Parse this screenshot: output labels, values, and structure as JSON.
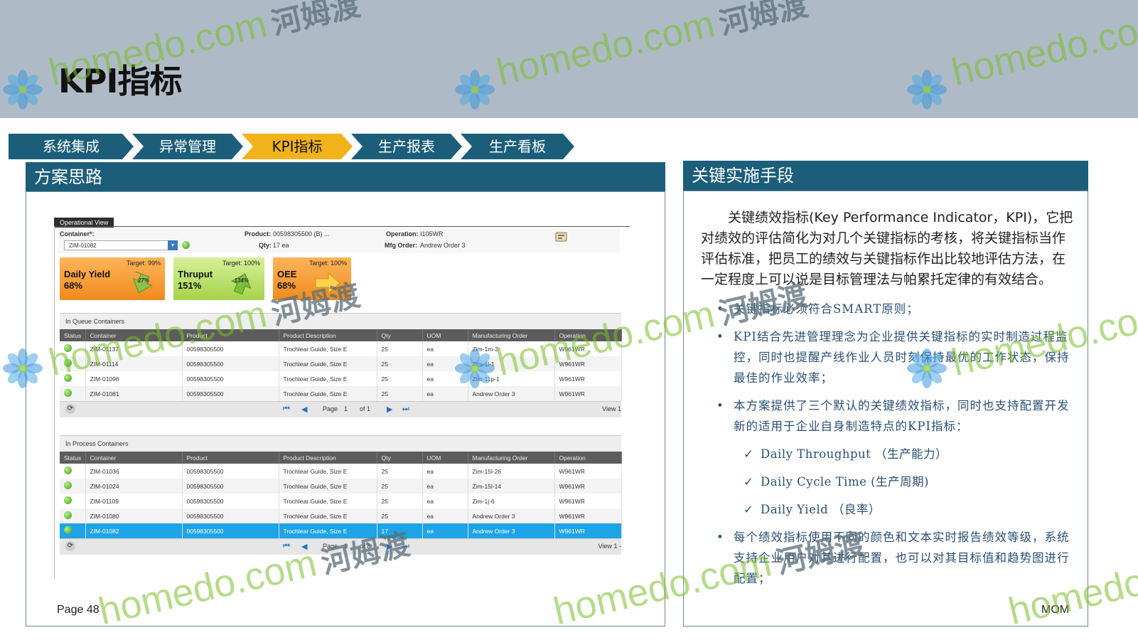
{
  "page_title": "KPI指标",
  "nav": [
    {
      "label": "系统集成",
      "active": false
    },
    {
      "label": "异常管理",
      "active": false
    },
    {
      "label": "KPI指标",
      "active": true
    },
    {
      "label": "生产报表",
      "active": false
    },
    {
      "label": "生产看板",
      "active": false
    }
  ],
  "left_panel": {
    "title": "方案思路"
  },
  "right_panel": {
    "title": "关键实施手段"
  },
  "watermark": {
    "text": "homedo.com",
    "cn": "河姆渡"
  },
  "screen": {
    "tab": "Operational View",
    "container_label": "Container*:",
    "container_value": "ZIM-01082",
    "product_label": "Product:",
    "product_value": "00598305500 (B) ...",
    "qty_label": "Qty:",
    "qty_value": "17 ea",
    "operation_label": "Operation:",
    "operation_value": "I105WR",
    "mfg_label": "Mfg Order:",
    "mfg_value": "Andrew Order 3",
    "kpis": [
      {
        "name": "Daily Yield",
        "value": "68%",
        "target": "Target: 99%",
        "pct": "27%",
        "color": "#f4902a"
      },
      {
        "name": "Thruput",
        "value": "151%",
        "target": "Target: 100%",
        "pct": "134%",
        "color": "#9ccf3e"
      },
      {
        "name": "OEE",
        "value": "68%",
        "target": "Target: 100%",
        "pct": "",
        "color": "#f4902a"
      }
    ],
    "queue": {
      "caption": "In Queue Containers",
      "columns": [
        "Status",
        "Container",
        "Product",
        "Product Description",
        "Qty",
        "UOM",
        "Manufacturing Order",
        "Operation"
      ],
      "rows": [
        [
          "",
          "ZIM-01137",
          "00598305500",
          "Trochlear Guide, Size E",
          "25",
          "ea",
          "Zim-1m-3",
          "W961WR"
        ],
        [
          "",
          "ZIM-01114",
          "00598305500",
          "Trochlear Guide, Size E",
          "25",
          "ea",
          "Zim-1i-1",
          "W961WR"
        ],
        [
          "",
          "ZIM-01096",
          "00598305500",
          "Trochlear Guide, Size E",
          "25",
          "ea",
          "Zim-11p-1",
          "W961WR"
        ],
        [
          "",
          "ZIM-01081",
          "00598305500",
          "Trochlear Guide, Size E",
          "25",
          "ea",
          "Andrew Order 3",
          "W961WR"
        ]
      ],
      "page_label": "Page",
      "page_value": "1",
      "of_label": "of 1",
      "view_label": "View 1"
    },
    "process": {
      "caption": "In Process Containers",
      "columns": [
        "Status",
        "Container",
        "Product",
        "Product Description",
        "Qty",
        "UOM",
        "Manufacturing Order",
        "Operation"
      ],
      "rows": [
        [
          "",
          "ZIM-01036",
          "00598305500",
          "Trochlear Guide, Size E",
          "25",
          "ea",
          "Zim-15l-26",
          "W961WR"
        ],
        [
          "",
          "ZIM-01024",
          "00598305500",
          "Trochlear Guide, Size E",
          "25",
          "ea",
          "Zim-15l-14",
          "W961WR"
        ],
        [
          "",
          "ZIM-01109",
          "00598305500",
          "Trochlear Guide, Size E",
          "25",
          "ea",
          "Zim-1j-6",
          "W961WR"
        ],
        [
          "",
          "ZIM-01080",
          "00598305500",
          "Trochlear Guide, Size E",
          "25",
          "ea",
          "Andrew Order 3",
          "W961WR"
        ],
        [
          "",
          "ZIM-01082",
          "00598305500",
          "Trochlear Guide, Size E",
          "17",
          "ea",
          "Andrew Order 3",
          "W961WR"
        ]
      ],
      "selected_row": 4,
      "page_label": "Page",
      "page_value": "1",
      "of_label": "of 8",
      "view_label": "View 1 -"
    }
  },
  "page_number": "Page 48",
  "footer_right": "MOM",
  "intro": "关键绩效指标(Key Performance Indicator，KPI)，它把对绩效的评估简化为对几个关键指标的考核，将关键指标当作评估标准，把员工的绩效与关键指标作出比较地评估方法，在一定程度上可以说是目标管理法与帕累托定律的有效结合。",
  "bullets": [
    "关键指标必须符合SMART原则；",
    "KPI结合先进管理理念为企业提供关键指标的实时制造过程监控，同时也提醒产线作业人员时刻保持最优的工作状态，保持最佳的作业效率；",
    "本方案提供了三个默认的关键绩效指标，同时也支持配置开发新的适用于企业自身制造特点的KPI指标："
  ],
  "checks": [
    "Daily Throughput （生产能力）",
    "Daily Cycle Time (生产周期)",
    "Daily Yield （良率）"
  ],
  "last_bullet": "每个绩效指标使用不同的颜色和文本实时报告绩效等级，系统支持企业用户对其进行配置，也可以对其目标值和趋势图进行配置；"
}
